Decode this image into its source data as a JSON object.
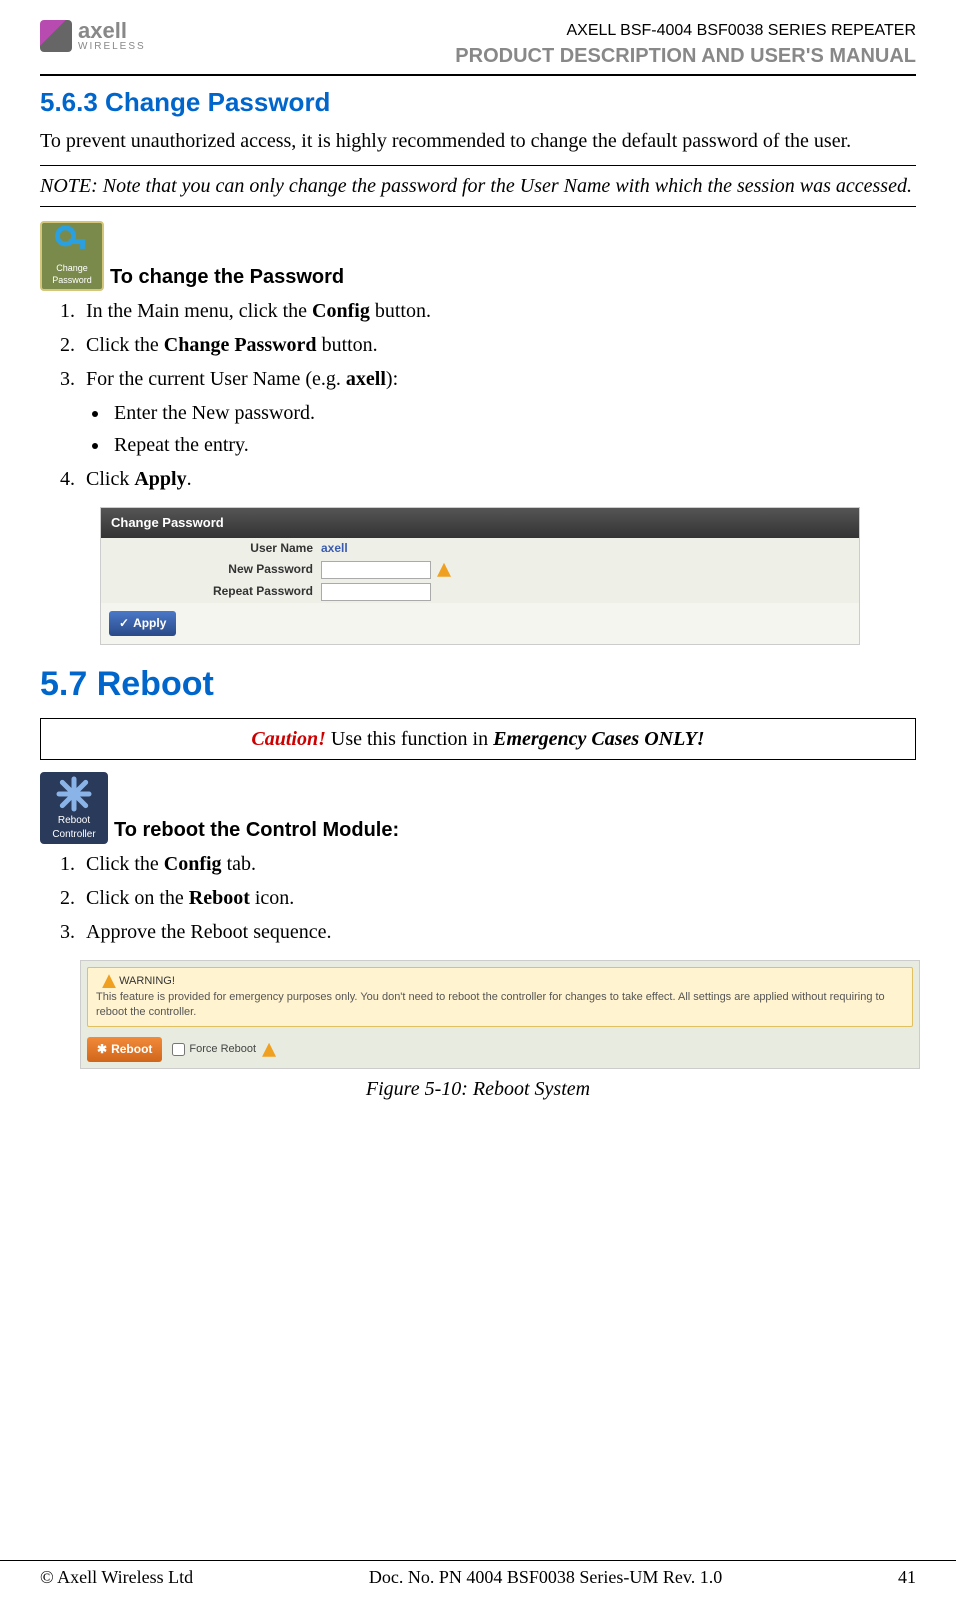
{
  "header": {
    "brand": "axell",
    "brand_sub": "WIRELESS",
    "product_line": "AXELL BSF-4004 BSF0038 SERIES REPEATER",
    "manual_title": "PRODUCT DESCRIPTION AND USER'S MANUAL"
  },
  "section_563": {
    "heading": "5.6.3   Change Password",
    "intro": "To prevent unauthorized access, it is highly recommended to change the default password of the user.",
    "note": "NOTE: Note that you can only change the password for the User Name with which the session was accessed.",
    "icon_text_top": "Change",
    "icon_text_bottom": "Password",
    "icon_label": "To change the Password",
    "steps": [
      {
        "pre": "In the Main menu, click the ",
        "bold": "Config",
        "post": " button."
      },
      {
        "pre": "Click the ",
        "bold": "Change Password",
        "post": " button."
      },
      {
        "pre": "For the current User Name (e.g. ",
        "bold": "axell",
        "post": "):"
      }
    ],
    "sub_bullets": [
      "Enter the New password.",
      "Repeat the entry."
    ],
    "step4": {
      "pre": "Click ",
      "bold": "Apply",
      "post": "."
    }
  },
  "pw_panel": {
    "title": "Change Password",
    "rows": {
      "user_name_label": "User Name",
      "user_name_value": "axell",
      "new_pw_label": "New Password",
      "repeat_pw_label": "Repeat Password"
    },
    "apply_label": "Apply"
  },
  "section_57": {
    "heading": "5.7   Reboot",
    "caution_label": "Caution!",
    "caution_rest": " Use this function in ",
    "caution_em": "Emergency Cases ONLY!",
    "icon_text_top": "Reboot",
    "icon_text_bottom": "Controller",
    "icon_label": "To reboot the Control Module:",
    "steps": [
      {
        "pre": "Click the ",
        "bold": "Config",
        "post": " tab."
      },
      {
        "pre": "Click on the ",
        "bold": "Reboot",
        "post": " icon."
      },
      {
        "pre": "Approve the Reboot sequence.",
        "bold": "",
        "post": ""
      }
    ]
  },
  "reboot_panel": {
    "warning_title": "WARNING!",
    "warning_body": "This feature is provided for emergency purposes only. You don't need to reboot the controller for changes to take effect. All settings are applied without requiring to reboot the controller.",
    "reboot_btn": "Reboot",
    "force_label": "Force Reboot"
  },
  "figure_caption": "Figure 5-10:  Reboot System",
  "footer": {
    "left": "© Axell Wireless Ltd",
    "center": "Doc. No. PN 4004 BSF0038 Series-UM Rev. 1.0",
    "right": "41"
  }
}
